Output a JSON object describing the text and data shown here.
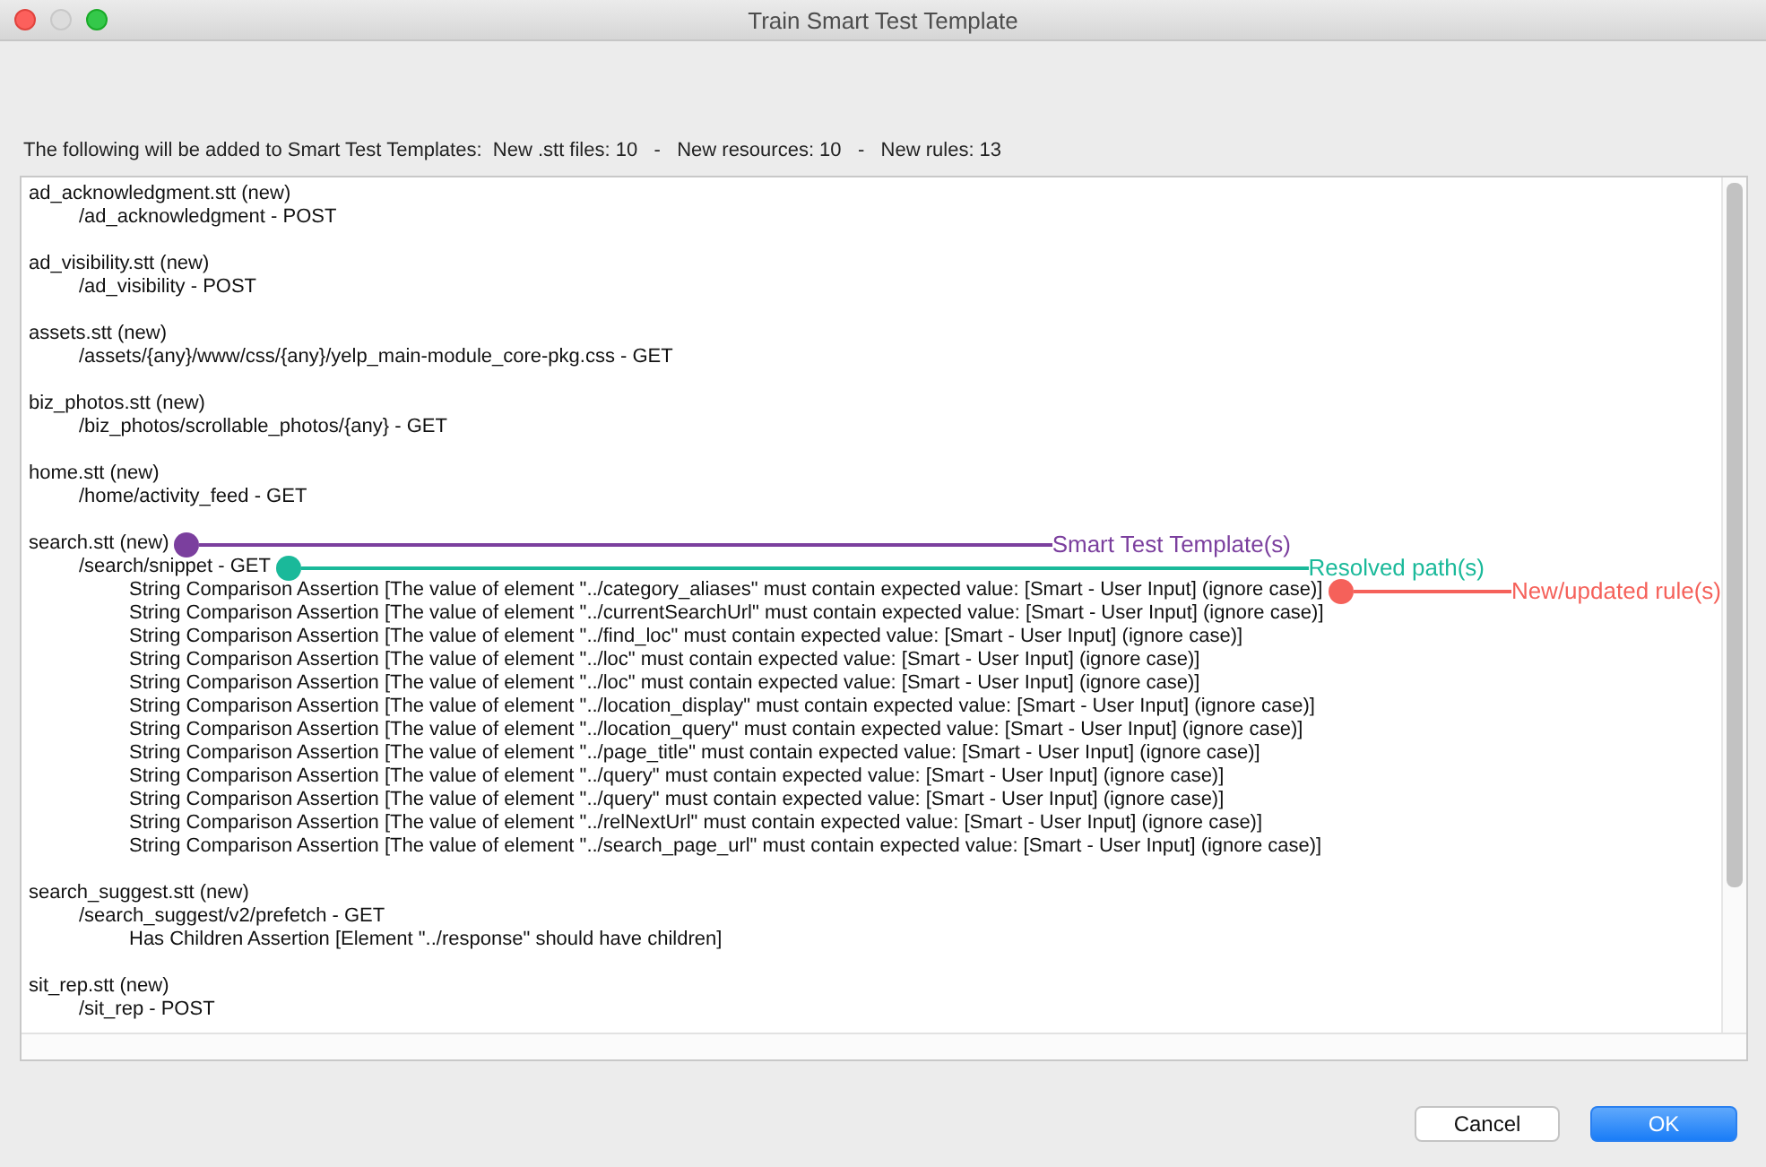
{
  "window": {
    "title": "Train Smart Test Template"
  },
  "summary": "The following will be added to Smart Test Templates:  New .stt files: 10   -   New resources: 10   -   New rules: 13",
  "files": [
    {
      "name": "ad_acknowledgment.stt (new)",
      "resources": [
        {
          "path": "/ad_acknowledgment - POST"
        }
      ]
    },
    {
      "name": "ad_visibility.stt (new)",
      "resources": [
        {
          "path": "/ad_visibility - POST"
        }
      ]
    },
    {
      "name": "assets.stt (new)",
      "resources": [
        {
          "path": "/assets/{any}/www/css/{any}/yelp_main-module_core-pkg.css - GET"
        }
      ]
    },
    {
      "name": "biz_photos.stt (new)",
      "resources": [
        {
          "path": "/biz_photos/scrollable_photos/{any} - GET"
        }
      ]
    },
    {
      "name": "home.stt (new)",
      "resources": [
        {
          "path": "/home/activity_feed - GET"
        }
      ]
    },
    {
      "name": "search.stt (new)",
      "callout": {
        "label": "Smart Test Template(s)",
        "color": "#7b3f9e"
      },
      "resources": [
        {
          "path": "/search/snippet - GET",
          "callout": {
            "label": "Resolved path(s)",
            "color": "#1ab99a"
          },
          "rules": [
            {
              "text": "String Comparison Assertion [The value of element \"../category_aliases\" must contain expected value: [Smart - User Input] (ignore case)]",
              "callout": {
                "label": "New/updated rule(s)",
                "color": "#f5615a"
              }
            },
            {
              "text": "String Comparison Assertion [The value of element \"../currentSearchUrl\" must contain expected value: [Smart - User Input] (ignore case)]"
            },
            {
              "text": "String Comparison Assertion [The value of element \"../find_loc\" must contain expected value: [Smart - User Input] (ignore case)]"
            },
            {
              "text": "String Comparison Assertion [The value of element \"../loc\" must contain expected value: [Smart - User Input] (ignore case)]"
            },
            {
              "text": "String Comparison Assertion [The value of element \"../loc\" must contain expected value: [Smart - User Input] (ignore case)]"
            },
            {
              "text": "String Comparison Assertion [The value of element \"../location_display\" must contain expected value: [Smart - User Input] (ignore case)]"
            },
            {
              "text": "String Comparison Assertion [The value of element \"../location_query\" must contain expected value: [Smart - User Input] (ignore case)]"
            },
            {
              "text": "String Comparison Assertion [The value of element \"../page_title\" must contain expected value: [Smart - User Input] (ignore case)]"
            },
            {
              "text": "String Comparison Assertion [The value of element \"../query\" must contain expected value: [Smart - User Input] (ignore case)]"
            },
            {
              "text": "String Comparison Assertion [The value of element \"../query\" must contain expected value: [Smart - User Input] (ignore case)]"
            },
            {
              "text": "String Comparison Assertion [The value of element \"../relNextUrl\" must contain expected value: [Smart - User Input] (ignore case)]"
            },
            {
              "text": "String Comparison Assertion [The value of element \"../search_page_url\" must contain expected value: [Smart - User Input] (ignore case)]"
            }
          ]
        }
      ]
    },
    {
      "name": "search_suggest.stt (new)",
      "resources": [
        {
          "path": "/search_suggest/v2/prefetch - GET",
          "rules": [
            {
              "text": "Has Children Assertion [Element \"../response\" should have children]"
            }
          ]
        }
      ]
    },
    {
      "name": "sit_rep.stt (new)",
      "resources": [
        {
          "path": "/sit_rep - POST"
        }
      ]
    }
  ],
  "buttons": [
    {
      "label": "Cancel",
      "kind": "secondary"
    },
    {
      "label": "OK",
      "kind": "primary"
    }
  ]
}
